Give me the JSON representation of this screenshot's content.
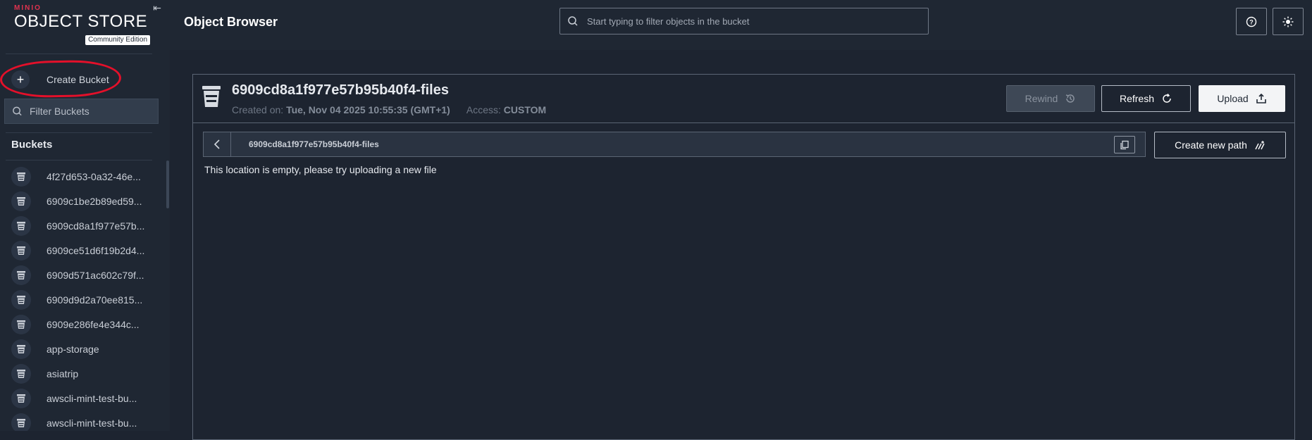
{
  "sidebar": {
    "logo": {
      "brand": "MINIO",
      "product": "OBJECT STORE",
      "edition": "Community Edition"
    },
    "create_bucket_label": "Create Bucket",
    "filter_placeholder": "Filter Buckets",
    "buckets_title": "Buckets",
    "buckets": [
      "4f27d653-0a32-46e...",
      "6909c1be2b89ed59...",
      "6909cd8a1f977e57b...",
      "6909ce51d6f19b2d4...",
      "6909d571ac602c79f...",
      "6909d9d2a70ee815...",
      "6909e286fe4e344c...",
      "app-storage",
      "asiatrip",
      "awscli-mint-test-bu...",
      "awscli-mint-test-bu..."
    ]
  },
  "topbar": {
    "title": "Object Browser",
    "search_placeholder": "Start typing to filter objects in the bucket"
  },
  "bucket": {
    "name": "6909cd8a1f977e57b95b40f4-files",
    "created_label": "Created on:",
    "created_value": "Tue, Nov 04 2025 10:55:35 (GMT+1)",
    "access_label": "Access:",
    "access_value": "CUSTOM"
  },
  "actions": {
    "rewind_label": "Rewind",
    "refresh_label": "Refresh",
    "upload_label": "Upload",
    "create_path_label": "Create new path"
  },
  "path_bar": {
    "path": "6909cd8a1f977e57b95b40f4-files"
  },
  "empty_message": "This location is empty, please try uploading a new file",
  "colors": {
    "background": "#1d2430",
    "sidebar": "#1f2733",
    "annotation": "#e3102a",
    "upload_button": "#f3f4f6"
  }
}
